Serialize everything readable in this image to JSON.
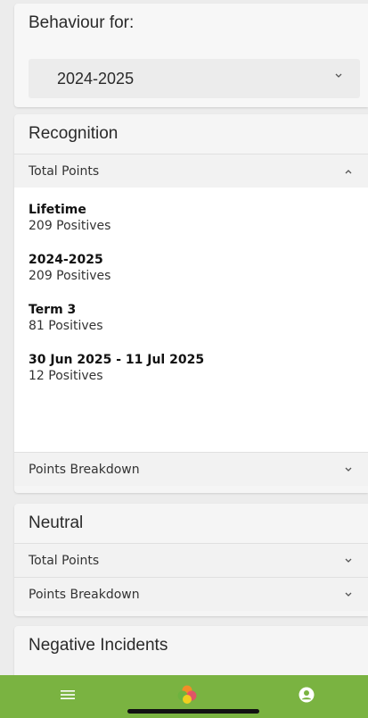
{
  "behaviour": {
    "title": "Behaviour for:",
    "selected_year": "2024-2025"
  },
  "recognition": {
    "title": "Recognition",
    "total_points_label": "Total Points",
    "stats": [
      {
        "label": "Lifetime",
        "value": "209 Positives"
      },
      {
        "label": "2024-2025",
        "value": "209 Positives"
      },
      {
        "label": "Term 3",
        "value": "81 Positives"
      },
      {
        "label": "30 Jun 2025 - 11 Jul 2025",
        "value": "12 Positives"
      }
    ],
    "breakdown_label": "Points Breakdown"
  },
  "neutral": {
    "title": "Neutral",
    "total_points_label": "Total Points",
    "breakdown_label": "Points Breakdown"
  },
  "negative": {
    "title": "Negative Incidents"
  },
  "bottom_nav": {
    "items": [
      "menu-icon",
      "home-logo-icon",
      "account-icon"
    ],
    "bar_color": "#7ab341"
  }
}
